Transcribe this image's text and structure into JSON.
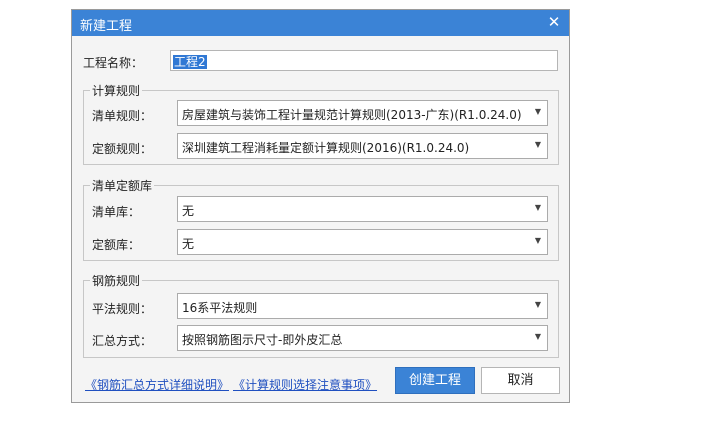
{
  "dialog": {
    "title": "新建工程",
    "close_glyph": "✕",
    "project_name_label": "工程名称：",
    "project_name_value": "工程2"
  },
  "calc_rules": {
    "legend": "计算规则",
    "bill_rule_label": "清单规则：",
    "bill_rule_value": "房屋建筑与装饰工程计量规范计算规则(2013-广东)(R1.0.24.0)",
    "quota_rule_label": "定额规则：",
    "quota_rule_value": "深圳建筑工程消耗量定额计算规则(2016)(R1.0.24.0)"
  },
  "bill_quota_lib": {
    "legend": "清单定额库",
    "bill_lib_label": "清单库：",
    "bill_lib_value": "无",
    "quota_lib_label": "定额库：",
    "quota_lib_value": "无"
  },
  "rebar_rules": {
    "legend": "钢筋规则",
    "flat_rule_label": "平法规则：",
    "flat_rule_value": "16系平法规则",
    "summary_label": "汇总方式：",
    "summary_value": "按照钢筋图示尺寸-即外皮汇总"
  },
  "footer": {
    "link_rebar_summary": "《钢筋汇总方式详细说明》",
    "link_calc_notes": "《计算规则选择注意事项》",
    "create_button": "创建工程",
    "cancel_button": "取消"
  },
  "icons": {
    "dropdown": "chevron-down-icon",
    "close": "close-icon"
  },
  "colors": {
    "titlebar": "#3b83d6",
    "link": "#2050c0",
    "selection": "#3078d4"
  }
}
